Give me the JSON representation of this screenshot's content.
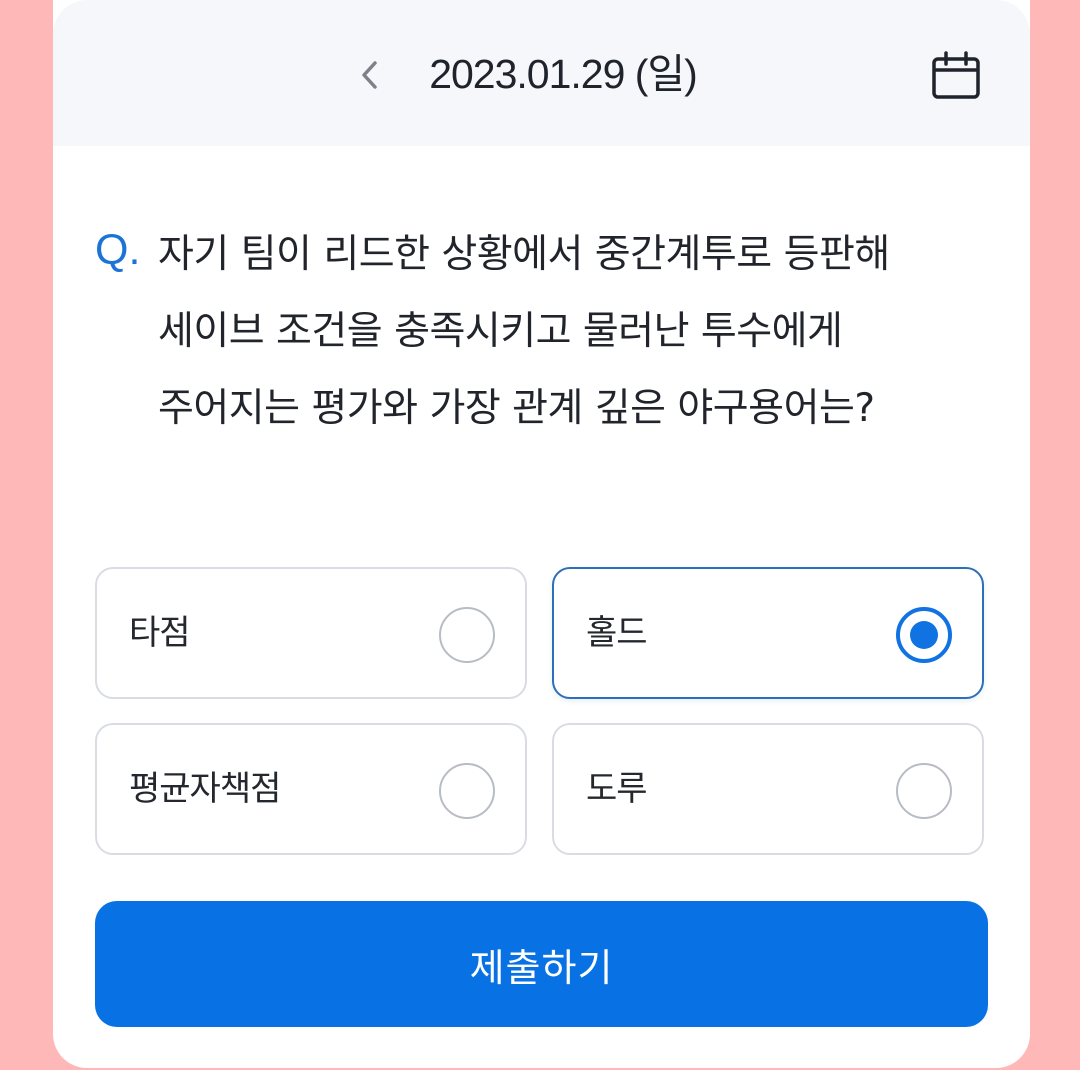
{
  "header": {
    "date": "2023.01.29 (일)",
    "back_icon": "chevron-left-icon",
    "calendar_icon": "calendar-icon"
  },
  "quiz": {
    "prefix": "Q.",
    "question": "자기 팀이 리드한 상황에서 중간계투로 등판해 세이브 조건을 충족시키고 물러난 투수에게 주어지는 평가와 가장 관계 깊은 야구용어는?",
    "options": [
      {
        "label": "타점",
        "selected": false
      },
      {
        "label": "홀드",
        "selected": true
      },
      {
        "label": "평균자책점",
        "selected": false
      },
      {
        "label": "도루",
        "selected": false
      }
    ],
    "submit_label": "제출하기"
  },
  "colors": {
    "accent": "#0872e4",
    "selected_border": "#2b70b9",
    "q_prefix": "#1b73d6",
    "background": "#ffb8b8",
    "header_bg": "#f6f7fb"
  }
}
